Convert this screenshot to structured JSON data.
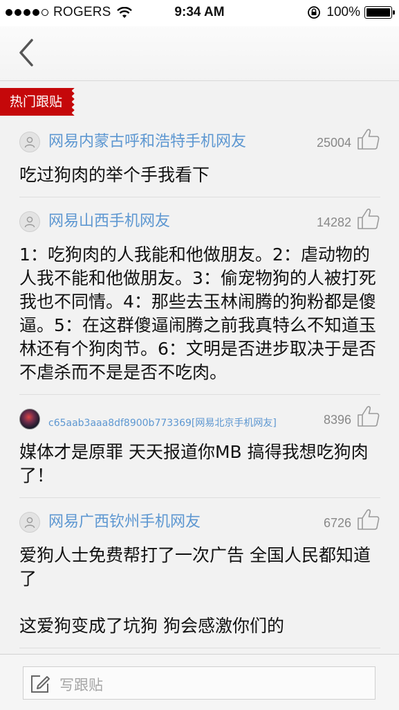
{
  "status_bar": {
    "carrier": "ROGERS",
    "time": "9:34 AM",
    "battery": "100%"
  },
  "section": {
    "label": "热门跟贴"
  },
  "comments": [
    {
      "user": "网易内蒙古呼和浩特手机网友",
      "votes": "25004",
      "text": "吃过狗肉的举个手我看下"
    },
    {
      "user": "网易山西手机网友",
      "votes": "14282",
      "text": "1：吃狗肉的人我能和他做朋友。2：虐动物的人我不能和他做朋友。3：偷宠物狗的人被打死我也不同情。4：那些去玉林闹腾的狗粉都是傻逼。5：在这群傻逼闹腾之前我真特么不知道玉林还有个狗肉节。6：文明是否进步取决于是否不虐杀而不是是否不吃肉。"
    },
    {
      "user": "c65aab3aaa8df8900b773369[网易北京手机网友]",
      "votes": "8396",
      "text": "媒体才是原罪 天天报道你MB 搞得我想吃狗肉了！"
    },
    {
      "user": "网易广西钦州手机网友",
      "votes": "6726",
      "text": "爱狗人士免费帮打了一次广告 全国人民都知道了\n\n这爱狗变成了坑狗 狗会感激你们的"
    }
  ],
  "compose": {
    "placeholder": "写跟贴"
  }
}
